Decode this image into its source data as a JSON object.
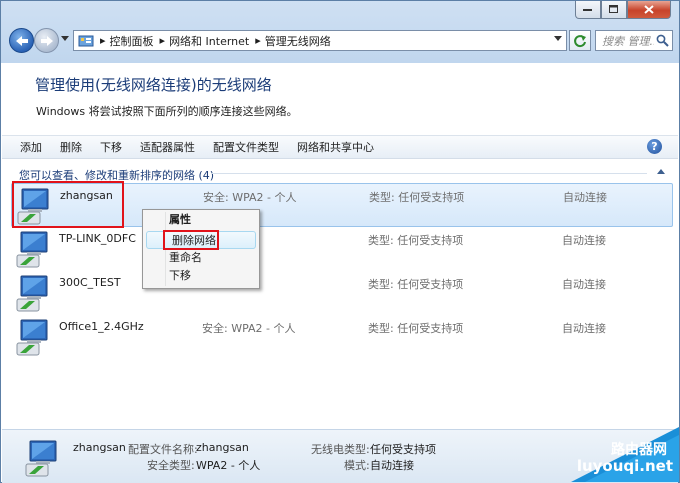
{
  "window": {
    "caption_buttons": [
      "minimize",
      "maximize",
      "close"
    ]
  },
  "address_bar": {
    "breadcrumbs": [
      "控制面板",
      "网络和 Internet",
      "管理无线网络"
    ],
    "search_placeholder": "搜索 管理..."
  },
  "page": {
    "title": "管理使用(无线网络连接)的无线网络",
    "subtitle": "Windows 将尝试按照下面所列的顺序连接这些网络。"
  },
  "toolbar": {
    "items": [
      "添加",
      "删除",
      "下移",
      "适配器属性",
      "配置文件类型",
      "网络和共享中心"
    ]
  },
  "group": {
    "header": "您可以查看、修改和重新排序的网络 (4)"
  },
  "networks": [
    {
      "name": "zhangsan",
      "security": "安全: WPA2 - 个人",
      "type": "类型: 任何受支持项",
      "mode": "自动连接",
      "selected": true
    },
    {
      "name": "TP-LINK_0DFC",
      "security": "",
      "type": "类型: 任何受支持项",
      "mode": "自动连接",
      "selected": false
    },
    {
      "name": "300C_TEST",
      "security": "",
      "type": "类型: 任何受支持项",
      "mode": "自动连接",
      "selected": false
    },
    {
      "name": "Office1_2.4GHz",
      "security": "安全: WPA2 - 个人",
      "type": "类型: 任何受支持项",
      "mode": "自动连接",
      "selected": false
    }
  ],
  "context_menu": {
    "items": [
      "属性",
      "删除网络",
      "重命名",
      "下移"
    ],
    "highlighted": "删除网络"
  },
  "details": {
    "name": "zhangsan",
    "profile_label": "配置文件名称:",
    "profile_value": "zhangsan",
    "security_label": "安全类型:",
    "security_value": "WPA2 - 个人",
    "radio_label": "无线电类型:",
    "radio_value": "任何受支持项",
    "mode_label": "模式:",
    "mode_value": "自动连接"
  },
  "watermark": {
    "line1": "路由器网",
    "line2": "luyouqi.net"
  },
  "colors": {
    "title": "#1b3c78",
    "highlight_border": "#e1131a",
    "selection": "#d6e8fa"
  }
}
